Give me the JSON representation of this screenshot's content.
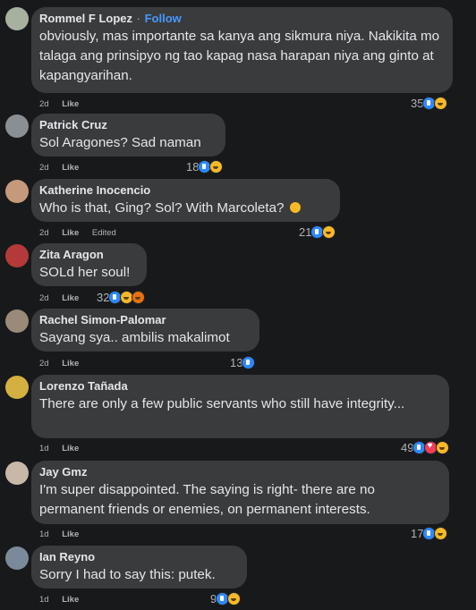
{
  "comments": [
    {
      "author": "Rommel F Lopez",
      "separator": "·",
      "follow": "Follow",
      "text": "obviously, mas importante sa kanya ang sikmura niya. Nakikita mo talaga ang prinsipyo ng tao kapag nasa harapan niya ang ginto at kapangyarihan.",
      "time": "2d",
      "like": "Like",
      "edited": "",
      "reaction_count": "35",
      "reactions": [
        "like-icon",
        "haha-icon"
      ],
      "avatar_color": "#a8b0a0"
    },
    {
      "author": "Patrick Cruz",
      "text": "Sol Aragones? Sad naman",
      "time": "2d",
      "like": "Like",
      "edited": "",
      "reaction_count": "18",
      "reactions": [
        "like-icon",
        "haha-icon"
      ],
      "avatar_color": "#8a8f94"
    },
    {
      "author": "Katherine Inocencio",
      "text": "Who is that, Ging? Sol? With Marcoleta?",
      "text_emoji": "thinking-emoji",
      "time": "2d",
      "like": "Like",
      "edited": "Edited",
      "reaction_count": "21",
      "reactions": [
        "like-icon",
        "sad-icon"
      ],
      "avatar_color": "#c49a7a"
    },
    {
      "author": "Zita Aragon",
      "text": "SOLd her soul!",
      "time": "2d",
      "like": "Like",
      "edited": "",
      "reaction_count": "32",
      "reactions": [
        "like-icon",
        "sad-icon",
        "angry-icon"
      ],
      "avatar_color": "#b43a3a"
    },
    {
      "author": "Rachel Simon-Palomar",
      "text": "Sayang sya.. ambilis makalimot",
      "time": "2d",
      "like": "Like",
      "edited": "",
      "reaction_count": "13",
      "reactions": [
        "like-icon"
      ],
      "avatar_color": "#9a8a78"
    },
    {
      "author": "Lorenzo Tañada",
      "text": "There are only a few public servants who still have integrity...",
      "time": "1d",
      "like": "Like",
      "edited": "",
      "reaction_count": "49",
      "reactions": [
        "like-icon",
        "love-icon",
        "sad-icon"
      ],
      "avatar_color": "#d4b040"
    },
    {
      "author": "Jay Gmz",
      "text": "I'm super disappointed. The saying is right- there are no permanent friends or enemies, on permanent interests.",
      "time": "1d",
      "like": "Like",
      "edited": "",
      "reaction_count": "17",
      "reactions": [
        "like-icon",
        "sad-icon"
      ],
      "avatar_color": "#c8b8a8"
    },
    {
      "author": "Ian Reyno",
      "text": "Sorry I had to say this: putek.",
      "time": "1d",
      "like": "Like",
      "edited": "",
      "reaction_count": "9",
      "reactions": [
        "like-icon",
        "haha-icon"
      ],
      "avatar_color": "#7a8a9a"
    }
  ]
}
